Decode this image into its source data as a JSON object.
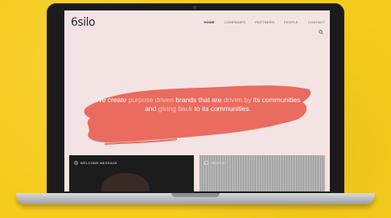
{
  "site": {
    "logo": "6silo",
    "nav": [
      "HOME",
      "COMPANIES",
      "PARTNERS",
      "PEOPLE",
      "CONTACT"
    ]
  },
  "hero": {
    "parts": [
      {
        "t": "We create ",
        "hl": false
      },
      {
        "t": "purpose driven ",
        "hl": true
      },
      {
        "t": "brands that are ",
        "hl": false
      },
      {
        "t": "driven by ",
        "hl": true
      },
      {
        "t": "its communities and ",
        "hl": false
      },
      {
        "t": "giving back ",
        "hl": true
      },
      {
        "t": "to its communities.",
        "hl": false
      }
    ]
  },
  "cards": [
    {
      "label": "WELCOME MESSAGE"
    },
    {
      "label": "PEOPLE"
    }
  ],
  "colors": {
    "background": "#f6cc1c",
    "screen_bg": "#f4e3e3",
    "brush": "#ea6b5f",
    "highlight_text": "#f7c7c0"
  }
}
